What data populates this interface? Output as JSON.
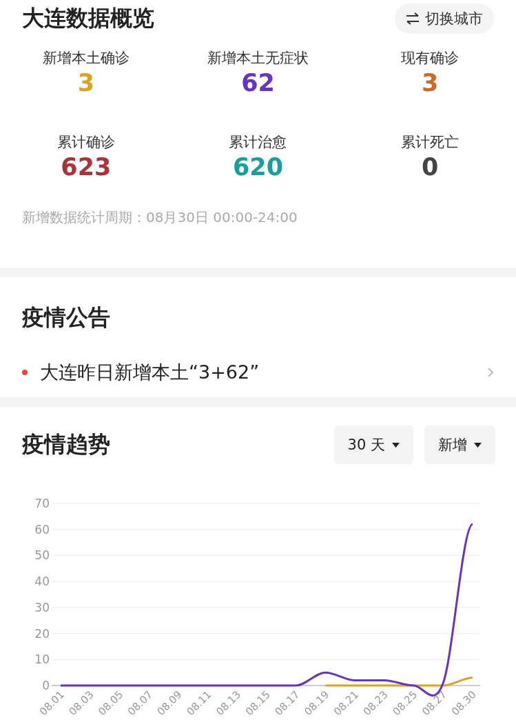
{
  "overview": {
    "title": "大连数据概览",
    "switch_button": "切换城市",
    "stats": [
      {
        "label": "新增本土确诊",
        "value": "3",
        "color": "#d9a520"
      },
      {
        "label": "新增本土无症状",
        "value": "62",
        "color": "#6633c4"
      },
      {
        "label": "现有确诊",
        "value": "3",
        "color": "#cc6a2c"
      },
      {
        "label": "累计确诊",
        "value": "623",
        "color": "#a83436"
      },
      {
        "label": "累计治愈",
        "value": "620",
        "color": "#17a09b"
      },
      {
        "label": "累计死亡",
        "value": "0",
        "color": "#444444"
      }
    ],
    "period_note": "新增数据统计周期：08月30日 00:00-24:00"
  },
  "notices": {
    "title": "疫情公告",
    "items": [
      {
        "text": "大连昨日新增本土“3+62”"
      }
    ]
  },
  "trend": {
    "title": "疫情趋势",
    "filters": [
      {
        "label": "30 天"
      },
      {
        "label": "新增"
      }
    ],
    "chart_data": {
      "type": "line",
      "categories": [
        "08.01",
        "08.03",
        "08.05",
        "08.07",
        "08.09",
        "08.11",
        "08.13",
        "08.15",
        "08.17",
        "08.19",
        "08.21",
        "08.23",
        "08.25",
        "08.27",
        "08.30"
      ],
      "ylim": [
        0,
        70
      ],
      "yticks": [
        0,
        10,
        20,
        30,
        40,
        50,
        60,
        70
      ],
      "grid": true,
      "series": [
        {
          "color": "#d9a520",
          "values": [
            null,
            null,
            null,
            null,
            null,
            null,
            null,
            null,
            null,
            0,
            0,
            0,
            0,
            0,
            3
          ]
        },
        {
          "color": "#6633c4",
          "values": [
            0,
            0,
            0,
            0,
            0,
            0,
            0,
            0,
            0,
            5,
            2,
            2,
            0,
            1,
            62
          ]
        }
      ]
    }
  }
}
